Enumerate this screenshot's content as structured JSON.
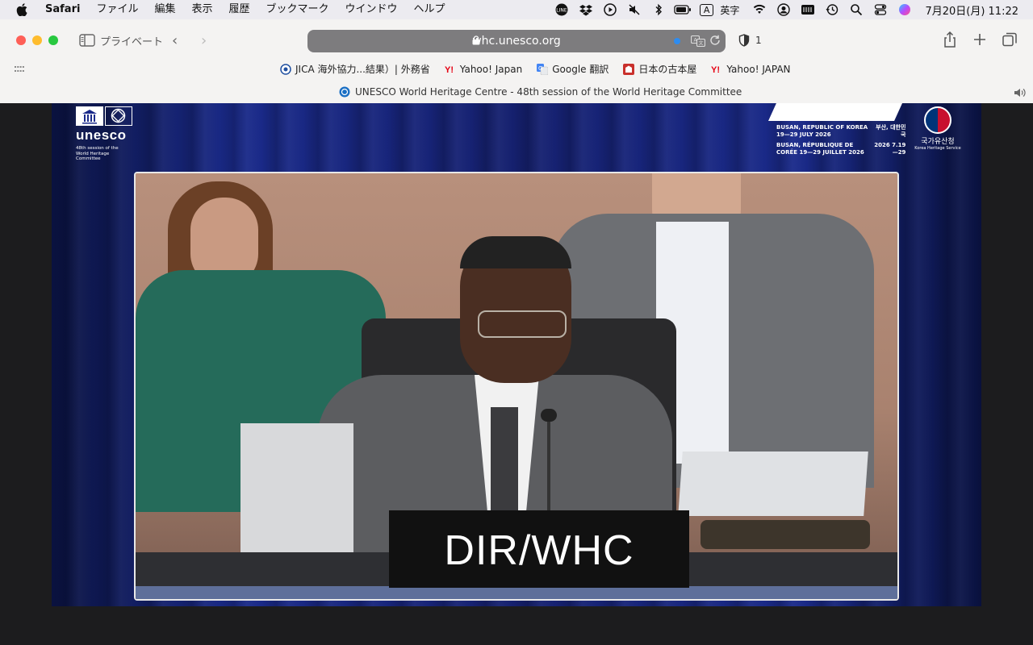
{
  "menubar": {
    "app_name": "Safari",
    "menus": [
      "ファイル",
      "編集",
      "表示",
      "履歴",
      "ブックマーク",
      "ウインドウ",
      "ヘルプ"
    ],
    "ime_badge": "A",
    "ime_label": "英字",
    "clock": "7月20日(月)  11:22"
  },
  "toolbar": {
    "private_label": "プライベート",
    "url": "whc.unesco.org",
    "blocked_count": "1"
  },
  "bookmarks": [
    {
      "label": "JICA 海外協力...結果）| 外務省",
      "icon": "globe-icon"
    },
    {
      "label": "Yahoo! Japan",
      "icon": "yahoo-icon"
    },
    {
      "label": "Google 翻訳",
      "icon": "google-translate-icon"
    },
    {
      "label": "日本の古本屋",
      "icon": "bookstore-icon"
    },
    {
      "label": "Yahoo! JAPAN",
      "icon": "yahoo-icon"
    }
  ],
  "tab": {
    "title": "UNESCO World Heritage Centre - 48th session of the World Heritage Committee"
  },
  "video": {
    "unesco_word": "unesco",
    "unesco_sub": "48th session of the World Heritage Committee",
    "busan_en": "BUSAN, REPUBLIC OF KOREA 19—29 JULY 2026",
    "busan_fr": "BUSAN, RÉPUBLIQUE DE CORÉE 19—29 JUILLET 2026",
    "busan_ko": "부산, 대한민국",
    "busan_dates": "2026 7.19—29",
    "korea_name": "국가유산청",
    "korea_sub": "Korea Heritage Service",
    "nameplate": "DIR/WHC"
  },
  "colors": {
    "stage_blue": "#15206e",
    "traffic_red": "#fe5f57",
    "traffic_yellow": "#febc2e",
    "traffic_green": "#28c840"
  }
}
